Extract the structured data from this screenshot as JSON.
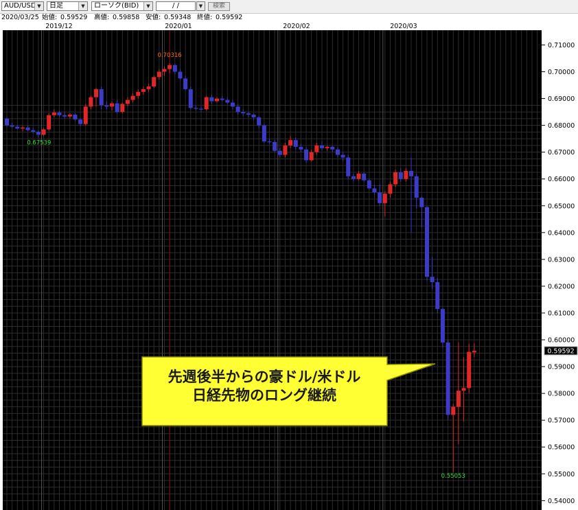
{
  "toolbar": {
    "symbol": "AUD/USD",
    "timeframe": "日足",
    "chart_style": "ローソク(BID)",
    "date_value": "/ /",
    "search_label": "検索"
  },
  "ohlc": {
    "date": "2020/03/25",
    "open_label": "始値:",
    "open": "0.59529",
    "high_label": "高値:",
    "high": "0.59858",
    "low_label": "安値:",
    "low": "0.59348",
    "close_label": "終値:",
    "close": "0.59592"
  },
  "colors": {
    "background": "#000000",
    "grid": "#2d2d2d",
    "up": "#e02828",
    "down": "#3c3cc8",
    "high_label": "#ff6a00",
    "low_label": "#33dd33",
    "callout_fill": "#ffff33",
    "callout_border": "#8a8a00"
  },
  "chart_data": {
    "type": "candlestick",
    "symbol": "AUD/USD",
    "x_labels": [
      "2019/12",
      "2020/01",
      "2020/02",
      "2020/03"
    ],
    "y_ticks": [
      "0.71000",
      "0.70000",
      "0.69000",
      "0.68000",
      "0.67000",
      "0.66000",
      "0.65000",
      "0.64000",
      "0.63000",
      "0.62000",
      "0.61000",
      "0.60000",
      "0.59000",
      "0.58000",
      "0.57000",
      "0.56000",
      "0.55000",
      "0.54000"
    ],
    "ylim": [
      0.5365,
      0.7155
    ],
    "current_price": "0.59592",
    "high_annotation": "0.70316",
    "low_annotations": [
      "0.67539",
      "0.55053"
    ],
    "callout": [
      "先週後半からの豪ドル/米ドル",
      "日経先物のロング継続"
    ],
    "candles": [
      {
        "o": 0.6825,
        "h": 0.6831,
        "l": 0.6795,
        "c": 0.68
      },
      {
        "o": 0.68,
        "h": 0.681,
        "l": 0.679,
        "c": 0.6795
      },
      {
        "o": 0.6795,
        "h": 0.6802,
        "l": 0.6785,
        "c": 0.6788
      },
      {
        "o": 0.6788,
        "h": 0.6798,
        "l": 0.6778,
        "c": 0.6792
      },
      {
        "o": 0.6792,
        "h": 0.68,
        "l": 0.6778,
        "c": 0.6782
      },
      {
        "o": 0.6782,
        "h": 0.679,
        "l": 0.677,
        "c": 0.6776
      },
      {
        "o": 0.6776,
        "h": 0.6782,
        "l": 0.6754,
        "c": 0.6765
      },
      {
        "o": 0.6765,
        "h": 0.679,
        "l": 0.676,
        "c": 0.6785
      },
      {
        "o": 0.6785,
        "h": 0.6845,
        "l": 0.678,
        "c": 0.6838
      },
      {
        "o": 0.6838,
        "h": 0.686,
        "l": 0.683,
        "c": 0.6848
      },
      {
        "o": 0.6848,
        "h": 0.6855,
        "l": 0.683,
        "c": 0.6838
      },
      {
        "o": 0.6838,
        "h": 0.685,
        "l": 0.6825,
        "c": 0.6833
      },
      {
        "o": 0.6833,
        "h": 0.6845,
        "l": 0.6825,
        "c": 0.684
      },
      {
        "o": 0.684,
        "h": 0.6845,
        "l": 0.6815,
        "c": 0.6822
      },
      {
        "o": 0.6822,
        "h": 0.6825,
        "l": 0.6798,
        "c": 0.6805
      },
      {
        "o": 0.6805,
        "h": 0.688,
        "l": 0.68,
        "c": 0.687
      },
      {
        "o": 0.687,
        "h": 0.691,
        "l": 0.686,
        "c": 0.6905
      },
      {
        "o": 0.6905,
        "h": 0.694,
        "l": 0.687,
        "c": 0.6935
      },
      {
        "o": 0.6935,
        "h": 0.6945,
        "l": 0.686,
        "c": 0.6875
      },
      {
        "o": 0.6875,
        "h": 0.689,
        "l": 0.686,
        "c": 0.687
      },
      {
        "o": 0.687,
        "h": 0.689,
        "l": 0.6855,
        "c": 0.6882
      },
      {
        "o": 0.6882,
        "h": 0.6895,
        "l": 0.6845,
        "c": 0.685
      },
      {
        "o": 0.685,
        "h": 0.6885,
        "l": 0.6845,
        "c": 0.688
      },
      {
        "o": 0.688,
        "h": 0.6905,
        "l": 0.687,
        "c": 0.6895
      },
      {
        "o": 0.6895,
        "h": 0.692,
        "l": 0.6885,
        "c": 0.691
      },
      {
        "o": 0.691,
        "h": 0.6935,
        "l": 0.69,
        "c": 0.6925
      },
      {
        "o": 0.6925,
        "h": 0.6945,
        "l": 0.6915,
        "c": 0.6935
      },
      {
        "o": 0.6935,
        "h": 0.6955,
        "l": 0.6925,
        "c": 0.6945
      },
      {
        "o": 0.6945,
        "h": 0.6985,
        "l": 0.694,
        "c": 0.698
      },
      {
        "o": 0.698,
        "h": 0.701,
        "l": 0.697,
        "c": 0.7
      },
      {
        "o": 0.7,
        "h": 0.702,
        "l": 0.6985,
        "c": 0.701
      },
      {
        "o": 0.701,
        "h": 0.7032,
        "l": 0.6995,
        "c": 0.7025
      },
      {
        "o": 0.7025,
        "h": 0.703,
        "l": 0.699,
        "c": 0.7
      },
      {
        "o": 0.7,
        "h": 0.701,
        "l": 0.697,
        "c": 0.6975
      },
      {
        "o": 0.6975,
        "h": 0.6985,
        "l": 0.693,
        "c": 0.6935
      },
      {
        "o": 0.6935,
        "h": 0.6945,
        "l": 0.686,
        "c": 0.6865
      },
      {
        "o": 0.6865,
        "h": 0.6875,
        "l": 0.6855,
        "c": 0.6862
      },
      {
        "o": 0.6862,
        "h": 0.687,
        "l": 0.685,
        "c": 0.686
      },
      {
        "o": 0.686,
        "h": 0.691,
        "l": 0.6855,
        "c": 0.6905
      },
      {
        "o": 0.6905,
        "h": 0.6915,
        "l": 0.688,
        "c": 0.689
      },
      {
        "o": 0.689,
        "h": 0.6905,
        "l": 0.6885,
        "c": 0.69
      },
      {
        "o": 0.69,
        "h": 0.691,
        "l": 0.689,
        "c": 0.6895
      },
      {
        "o": 0.6895,
        "h": 0.6905,
        "l": 0.688,
        "c": 0.6885
      },
      {
        "o": 0.6885,
        "h": 0.6895,
        "l": 0.686,
        "c": 0.687
      },
      {
        "o": 0.687,
        "h": 0.688,
        "l": 0.684,
        "c": 0.685
      },
      {
        "o": 0.685,
        "h": 0.686,
        "l": 0.6835,
        "c": 0.6845
      },
      {
        "o": 0.6845,
        "h": 0.685,
        "l": 0.683,
        "c": 0.684
      },
      {
        "o": 0.684,
        "h": 0.6845,
        "l": 0.682,
        "c": 0.683
      },
      {
        "o": 0.683,
        "h": 0.6835,
        "l": 0.679,
        "c": 0.68
      },
      {
        "o": 0.68,
        "h": 0.6805,
        "l": 0.6735,
        "c": 0.674
      },
      {
        "o": 0.674,
        "h": 0.675,
        "l": 0.673,
        "c": 0.6738
      },
      {
        "o": 0.6738,
        "h": 0.6745,
        "l": 0.67,
        "c": 0.6705
      },
      {
        "o": 0.6705,
        "h": 0.6715,
        "l": 0.668,
        "c": 0.669
      },
      {
        "o": 0.669,
        "h": 0.6735,
        "l": 0.668,
        "c": 0.6725
      },
      {
        "o": 0.6725,
        "h": 0.676,
        "l": 0.6715,
        "c": 0.6745
      },
      {
        "o": 0.6745,
        "h": 0.6755,
        "l": 0.671,
        "c": 0.672
      },
      {
        "o": 0.672,
        "h": 0.673,
        "l": 0.67,
        "c": 0.671
      },
      {
        "o": 0.671,
        "h": 0.672,
        "l": 0.666,
        "c": 0.667
      },
      {
        "o": 0.667,
        "h": 0.671,
        "l": 0.6665,
        "c": 0.67
      },
      {
        "o": 0.67,
        "h": 0.6735,
        "l": 0.669,
        "c": 0.6725
      },
      {
        "o": 0.6725,
        "h": 0.674,
        "l": 0.6705,
        "c": 0.6715
      },
      {
        "o": 0.6715,
        "h": 0.6725,
        "l": 0.6705,
        "c": 0.672
      },
      {
        "o": 0.672,
        "h": 0.6725,
        "l": 0.67,
        "c": 0.671
      },
      {
        "o": 0.671,
        "h": 0.672,
        "l": 0.668,
        "c": 0.669
      },
      {
        "o": 0.669,
        "h": 0.67,
        "l": 0.6665,
        "c": 0.668
      },
      {
        "o": 0.668,
        "h": 0.669,
        "l": 0.66,
        "c": 0.661
      },
      {
        "o": 0.661,
        "h": 0.662,
        "l": 0.659,
        "c": 0.66
      },
      {
        "o": 0.66,
        "h": 0.663,
        "l": 0.6595,
        "c": 0.662
      },
      {
        "o": 0.662,
        "h": 0.6625,
        "l": 0.659,
        "c": 0.6595
      },
      {
        "o": 0.6595,
        "h": 0.66,
        "l": 0.656,
        "c": 0.6565
      },
      {
        "o": 0.6565,
        "h": 0.658,
        "l": 0.654,
        "c": 0.655
      },
      {
        "o": 0.655,
        "h": 0.658,
        "l": 0.65,
        "c": 0.651
      },
      {
        "o": 0.651,
        "h": 0.6555,
        "l": 0.646,
        "c": 0.6545
      },
      {
        "o": 0.6545,
        "h": 0.659,
        "l": 0.653,
        "c": 0.658
      },
      {
        "o": 0.658,
        "h": 0.6635,
        "l": 0.657,
        "c": 0.6625
      },
      {
        "o": 0.6625,
        "h": 0.664,
        "l": 0.659,
        "c": 0.66
      },
      {
        "o": 0.66,
        "h": 0.664,
        "l": 0.659,
        "c": 0.663
      },
      {
        "o": 0.663,
        "h": 0.668,
        "l": 0.64,
        "c": 0.661
      },
      {
        "o": 0.661,
        "h": 0.662,
        "l": 0.649,
        "c": 0.653
      },
      {
        "o": 0.653,
        "h": 0.6535,
        "l": 0.642,
        "c": 0.6495
      },
      {
        "o": 0.6495,
        "h": 0.65,
        "l": 0.622,
        "c": 0.6235
      },
      {
        "o": 0.6235,
        "h": 0.631,
        "l": 0.619,
        "c": 0.6215
      },
      {
        "o": 0.6215,
        "h": 0.623,
        "l": 0.61,
        "c": 0.6115
      },
      {
        "o": 0.6115,
        "h": 0.612,
        "l": 0.597,
        "c": 0.599
      },
      {
        "o": 0.599,
        "h": 0.6,
        "l": 0.57,
        "c": 0.572
      },
      {
        "o": 0.572,
        "h": 0.576,
        "l": 0.5505,
        "c": 0.575
      },
      {
        "o": 0.575,
        "h": 0.599,
        "l": 0.561,
        "c": 0.581
      },
      {
        "o": 0.581,
        "h": 0.5935,
        "l": 0.5695,
        "c": 0.582
      },
      {
        "o": 0.582,
        "h": 0.5985,
        "l": 0.58,
        "c": 0.5955
      },
      {
        "o": 0.5953,
        "h": 0.5986,
        "l": 0.5935,
        "c": 0.5959
      }
    ]
  }
}
